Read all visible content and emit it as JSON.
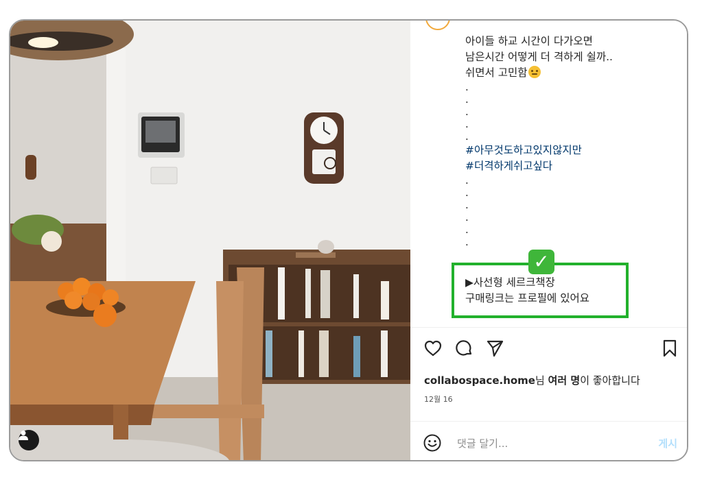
{
  "caption": {
    "lines": [
      "아이들 하교 시간이 다가오면",
      "남은시간 어떻게 더 격하게 쉴까..",
      "쉬면서 고민함"
    ],
    "dot": ".",
    "hashtags": [
      "#아무것도하고있지않지만",
      "#더격하게쉬고싶다"
    ],
    "promo_lines": [
      "▶사선형 세르크책장",
      "구매링크는 프로필에 있어요"
    ]
  },
  "post": {
    "username": "collabospace.home",
    "likes_middle": "님 ",
    "likes_bold": "여러 명",
    "likes_suffix": "이 좋아합니다",
    "date": "12월 16"
  },
  "comment": {
    "placeholder": "댓글 달기...",
    "post_label": "게시"
  },
  "icons": {
    "like": "heart-icon",
    "comment": "comment-icon",
    "share": "paper-plane-icon",
    "save": "bookmark-icon",
    "emoji": "smiley-icon",
    "user_tag": "user-tag-icon",
    "check": "check-mark-icon"
  },
  "colors": {
    "highlight": "#22b12c",
    "hashtag": "#00376b",
    "post_button": "#b2dffc"
  },
  "check_mark": "✓"
}
